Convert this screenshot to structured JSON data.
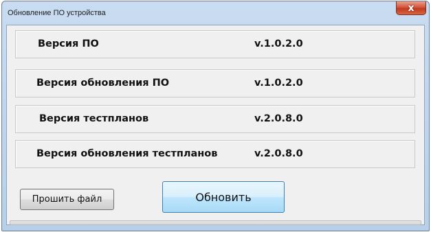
{
  "window": {
    "title": "Обновление ПО устройства",
    "close_glyph": "x"
  },
  "rows": [
    {
      "label": "Версия ПО",
      "value": "v.1.0.2.0"
    },
    {
      "label": "Версия обновления ПО",
      "value": "v.1.0.2.0"
    },
    {
      "label": "Версия тестпланов",
      "value": "v.2.0.8.0"
    },
    {
      "label": "Версия обновления тестпланов",
      "value": "v.2.0.8.0"
    }
  ],
  "buttons": {
    "flash_file": "Прошить файл",
    "update": "Обновить"
  },
  "progress": {
    "value_percent": 0
  },
  "colors": {
    "close_button": "#c13a20",
    "progress_fill": "#06b025",
    "update_button_border": "#3c7fb1"
  }
}
